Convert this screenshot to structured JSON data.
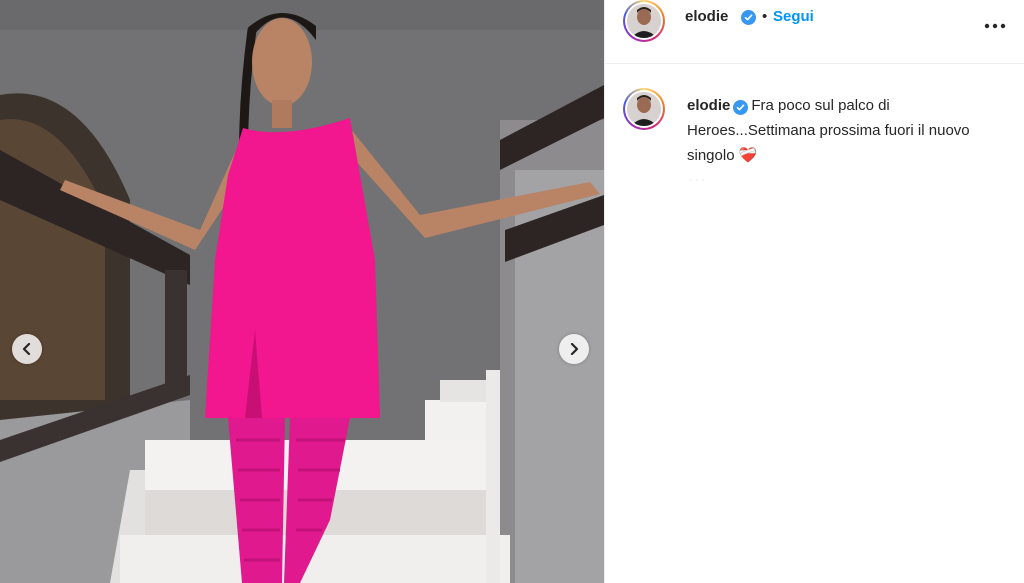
{
  "post": {
    "username": "elodie",
    "follow_label": "Segui",
    "separator": "•",
    "caption_text": "Fra poco sul palco di Heroes...Settimana prossima fuori il nuovo singolo",
    "caption_emoji": "❤‍🩹",
    "faint_text": "- - -"
  },
  "icons": {
    "verified": "verified-badge-icon",
    "more": "more-options-icon",
    "prev": "chevron-left-icon",
    "next": "chevron-right-icon",
    "emoji": "mending-heart-emoji"
  },
  "colors": {
    "accent": "#0095f6",
    "dress": "#f2168f",
    "text": "#262626"
  }
}
